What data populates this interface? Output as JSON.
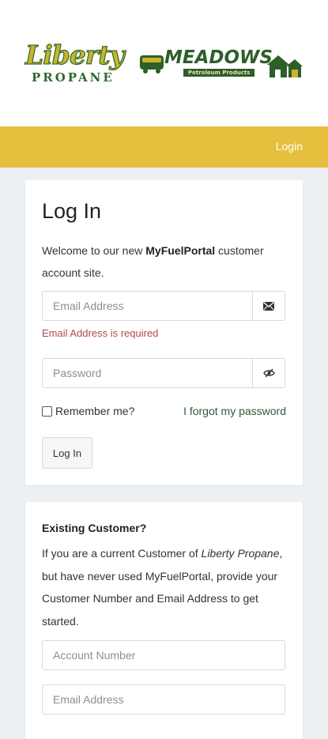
{
  "logos": {
    "liberty_word": "Liberty",
    "propane_word": "PROPANE",
    "meadows_word": "MEADOWS",
    "meadows_sub": "Petroleum Products"
  },
  "nav": {
    "login_label": "Login"
  },
  "login_card": {
    "title": "Log In",
    "welcome_pre": "Welcome to our new ",
    "welcome_brand": "MyFuelPortal",
    "welcome_post": " customer account site.",
    "email_placeholder": "Email Address",
    "email_error": "Email Address is required",
    "password_placeholder": "Password",
    "remember_label": "Remember me?",
    "forgot_label": "I forgot my password",
    "login_button": "Log In"
  },
  "existing_card": {
    "title": "Existing Customer?",
    "text_1": "If you are a current Customer of ",
    "text_company": "Liberty Propane",
    "text_2": ", but have never used MyFuelPortal, provide your Customer Number and Email Address to get started.",
    "account_placeholder": "Account Number",
    "email_placeholder": "Email Address"
  },
  "colors": {
    "navbar": "#e7bf3e",
    "brand_green": "#2e6a2c",
    "error_red": "#b24a4a"
  },
  "icons": {
    "email": "envelope-icon",
    "password": "eye-slash-icon"
  }
}
